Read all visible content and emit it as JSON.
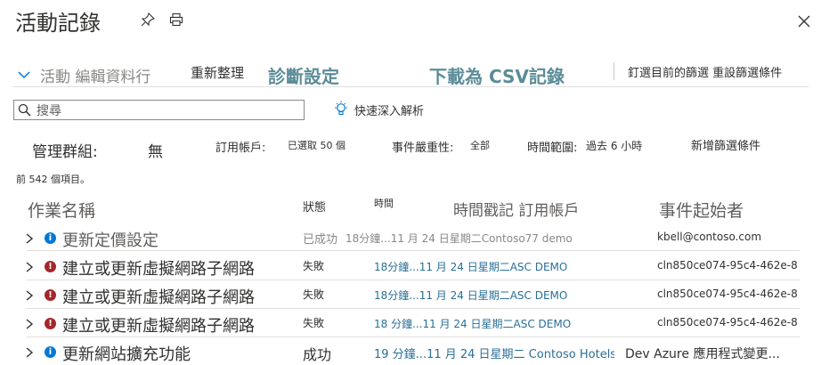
{
  "header": {
    "title": "活動記錄",
    "pin_icon": "pin-icon",
    "print_icon": "print-icon",
    "close_icon": "close-icon"
  },
  "toolbar": {
    "activity_columns": "活動 編輯資料行",
    "refresh": "重新整理",
    "diagnostic_settings": "診斷設定",
    "download_csv": "下載為 CSV記錄",
    "pin_reset": "釘選目前的篩選 重設篩選條件"
  },
  "search": {
    "placeholder": "搜尋",
    "quick_insights": "快速深入解析"
  },
  "filters": {
    "management_group_label": "管理群組:",
    "management_group_value": "無",
    "subscription_label": "訂用帳戶:",
    "subscription_value": "已選取 50 個",
    "severity_label": "事件嚴重性:",
    "severity_value": "全部",
    "timespan_label": "時間範圍:",
    "timespan_value": "過去 6 小時",
    "add_filter": "新增篩選條件"
  },
  "summary": "前 542 個項目。",
  "table": {
    "headers": {
      "operation": "作業名稱",
      "status": "狀態",
      "time": "時間",
      "timestamp_subscription": "時間戳記 訂用帳戶",
      "initiator": "事件起始者"
    },
    "rows": [
      {
        "operation": "更新定價設定",
        "status_type": "info",
        "status": "已成功",
        "time_subscription": "18分鐘...11 月 24 日星期二Contoso77 demo",
        "initiator": "kbell@contoso.com"
      },
      {
        "operation": "建立或更新虛擬網路子網路",
        "status_type": "error",
        "status": "失敗",
        "time_subscription": "18分鐘...11 月 24 日星期二ASC DEMO",
        "initiator": "cln850ce074-95c4-462e-8..."
      },
      {
        "operation": "建立或更新虛擬網路子網路",
        "status_type": "error",
        "status": "失敗",
        "time_subscription": "18分鐘...11 月 24 日星期二ASC DEMO",
        "initiator": "cln850ce074-95c4-462e-8..."
      },
      {
        "operation": "建立或更新虛擬網路子網路",
        "status_type": "error",
        "status": "失敗",
        "time_subscription": "18 分鐘...11 月 24 日星期二ASC DEMO",
        "initiator": "cln850ce074-95c4-462e-8..."
      },
      {
        "operation": "更新網站擴充功能",
        "status_type": "info",
        "status": "成功",
        "time_subscription": "19 分鐘...11 月 24 日星期二 Contoso Hotels -",
        "initiator": "Dev Azure 應用程式變更..."
      }
    ]
  },
  "colors": {
    "accent": "#0078d4",
    "toolbar_teal": "#5b8c98",
    "error": "#a4262c",
    "info": "#0078d4",
    "time_link": "#2a6f97"
  }
}
